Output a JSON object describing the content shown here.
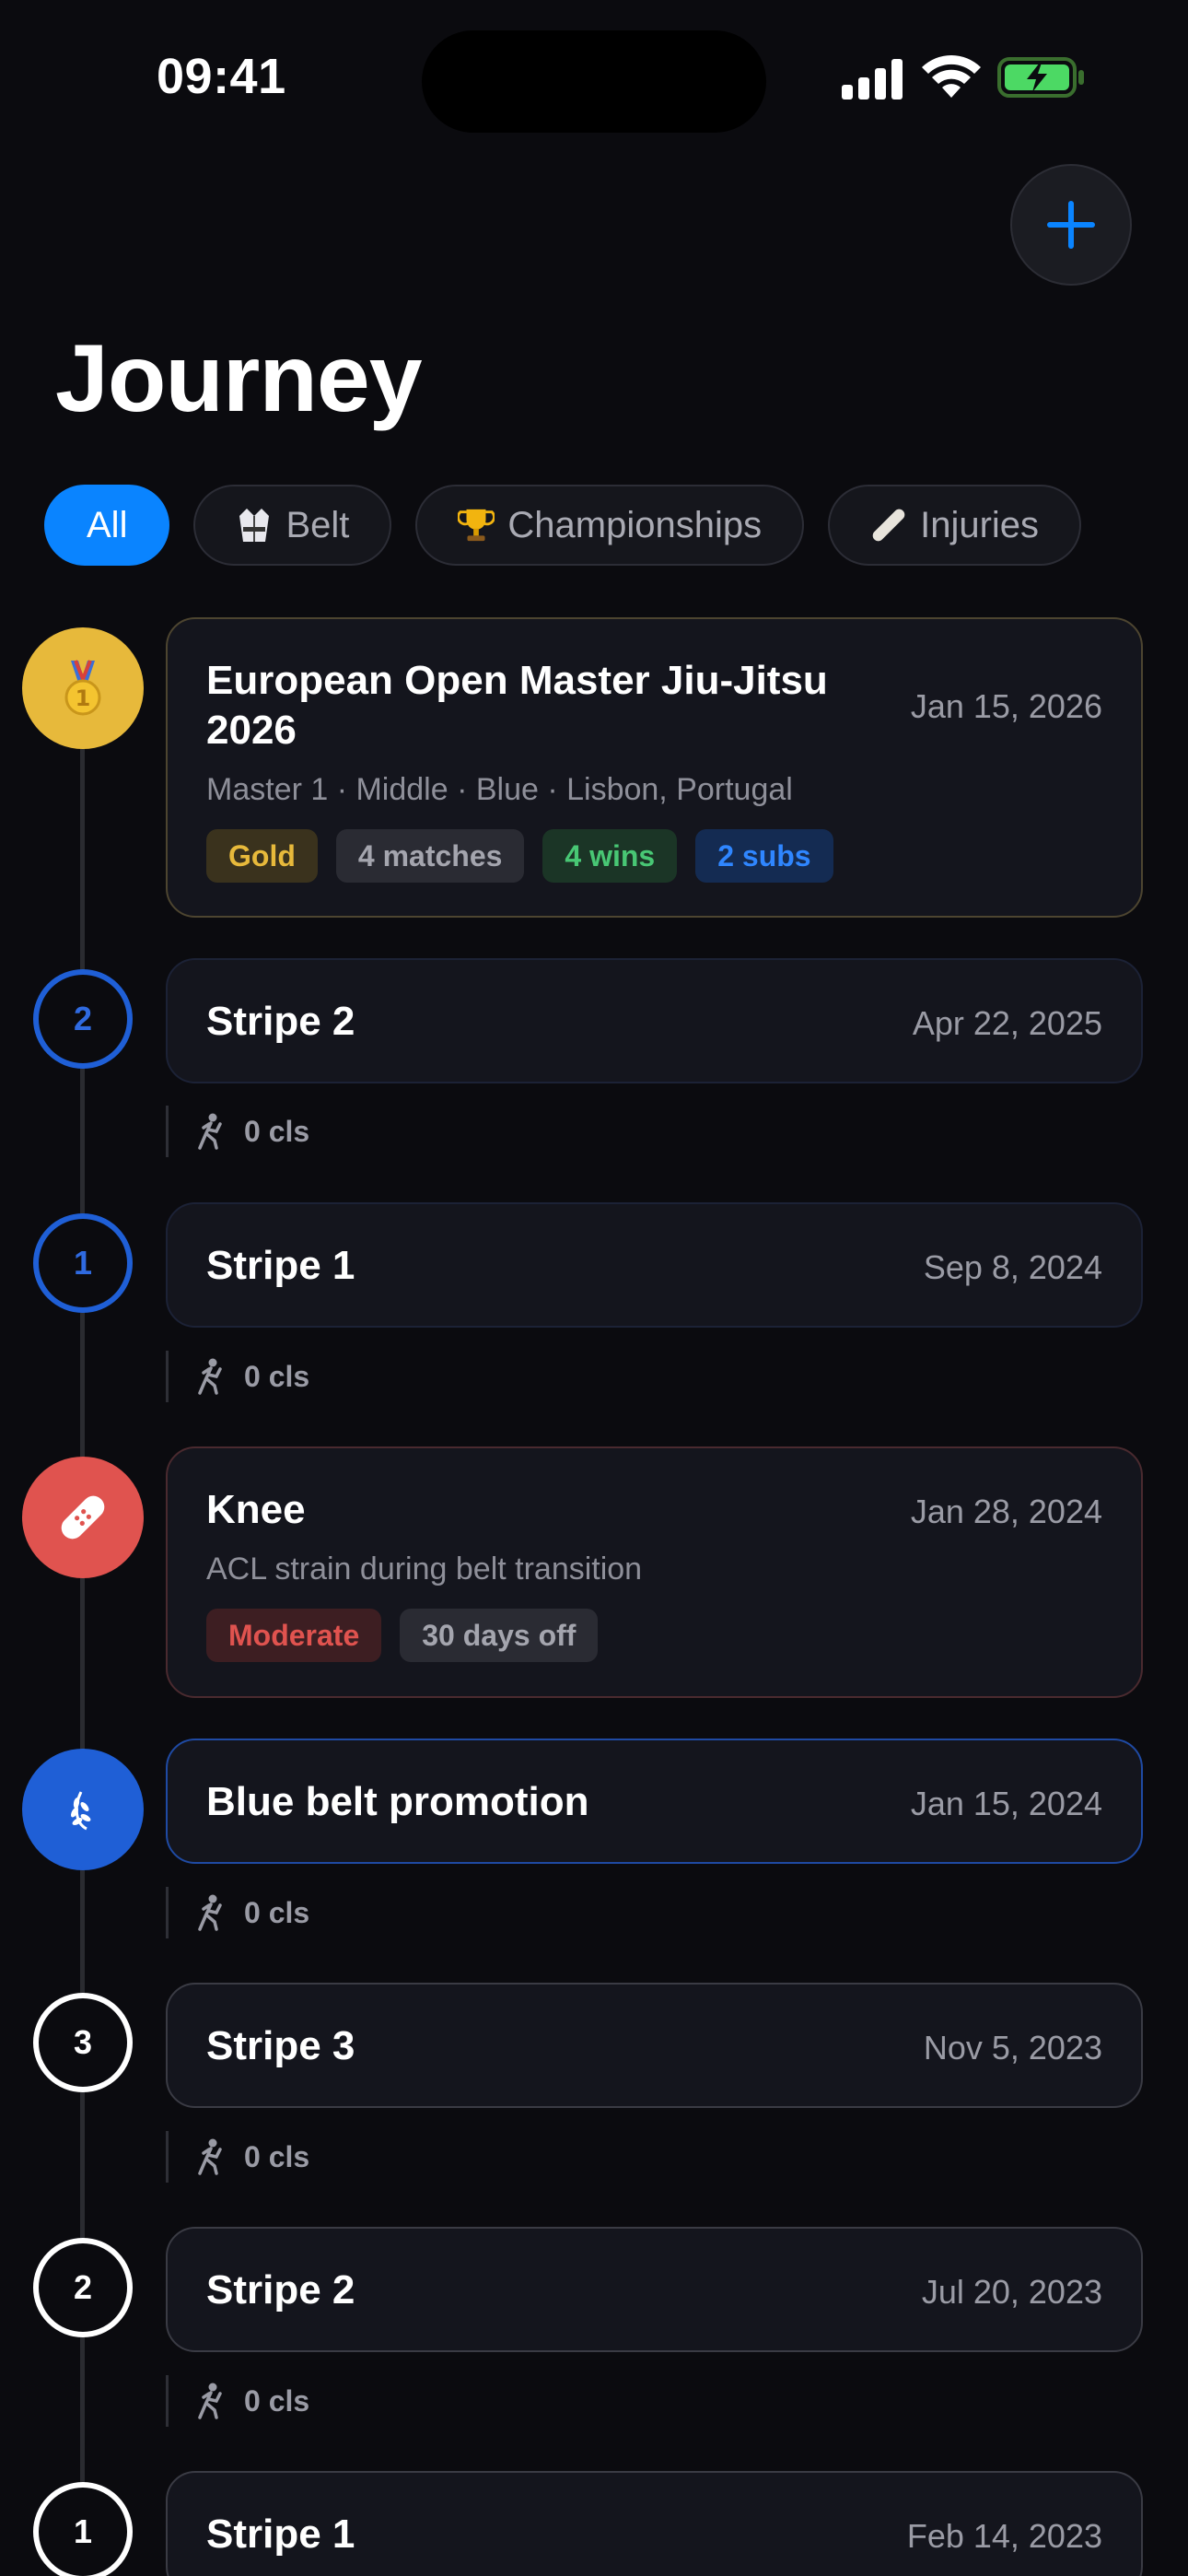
{
  "status": {
    "time": "09:41"
  },
  "header": {
    "title": "Journey"
  },
  "filters": [
    {
      "label": "All",
      "icon": null
    },
    {
      "label": "Belt",
      "icon": "gi-icon"
    },
    {
      "label": "Championships",
      "icon": "trophy-icon"
    },
    {
      "label": "Injuries",
      "icon": "bandage-icon"
    }
  ],
  "events": [
    {
      "title": "European Open Master Jiu-Jitsu 2026",
      "date": "Jan 15, 2026",
      "subtitle": "Master 1 · Middle · Blue · Lisbon, Portugal",
      "tags": [
        "Gold",
        "4 matches",
        "4 wins",
        "2 subs"
      ],
      "icon": "medal-icon"
    },
    {
      "title": "Stripe 2",
      "date": "Apr 22, 2025",
      "node": "2",
      "stat": "0 cls"
    },
    {
      "title": "Stripe 1",
      "date": "Sep 8, 2024",
      "node": "1",
      "stat": "0 cls"
    },
    {
      "title": "Knee",
      "date": "Jan 28, 2024",
      "subtitle": "ACL strain during belt transition",
      "tags": [
        "Moderate",
        "30 days off"
      ],
      "icon": "bandage-icon"
    },
    {
      "title": "Blue belt promotion",
      "date": "Jan 15, 2024",
      "icon": "laurel-icon",
      "stat": "0 cls"
    },
    {
      "title": "Stripe 3",
      "date": "Nov 5, 2023",
      "node": "3",
      "stat": "0 cls"
    },
    {
      "title": "Stripe 2",
      "date": "Jul 20, 2023",
      "node": "2",
      "stat": "0 cls"
    },
    {
      "title": "Stripe 1",
      "date": "Feb 14, 2023",
      "node": "1"
    }
  ],
  "colors": {
    "accent": "#0a84ff",
    "gold": "#e7b93b",
    "injury": "#e0534f",
    "belt_blue": "#1f5fd6"
  }
}
